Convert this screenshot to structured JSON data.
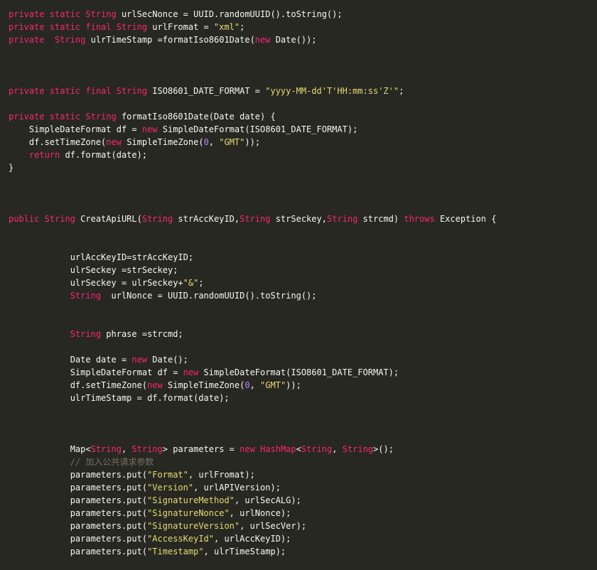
{
  "theme": {
    "background": "#272822",
    "plain": "#f8f8f2",
    "keyword": "#f92672",
    "string": "#e6db74",
    "number": "#ae81ff",
    "comment": "#75715e"
  },
  "code": {
    "lines": [
      [
        [
          "kw",
          "private static String"
        ],
        [
          "p",
          " urlSecNonce = UUID.randomUUID().toString();"
        ]
      ],
      [
        [
          "kw",
          "private static final String"
        ],
        [
          "p",
          " urlFromat = "
        ],
        [
          "str",
          "\"xml\""
        ],
        [
          "p",
          ";"
        ]
      ],
      [
        [
          "kw",
          "private  String"
        ],
        [
          "p",
          " ulrTimeStamp =formatIso8601Date("
        ],
        [
          "kw",
          "new"
        ],
        [
          "p",
          " Date());"
        ]
      ],
      [],
      [],
      [],
      [
        [
          "kw",
          "private static final String"
        ],
        [
          "p",
          " ISO8601_DATE_FORMAT = "
        ],
        [
          "str",
          "\"yyyy-MM-dd'T'HH:mm:ss'Z'\""
        ],
        [
          "p",
          ";"
        ]
      ],
      [],
      [
        [
          "kw",
          "private static String"
        ],
        [
          "p",
          " formatIso8601Date(Date date) {"
        ]
      ],
      [
        [
          "p",
          "    SimpleDateFormat df = "
        ],
        [
          "kw",
          "new"
        ],
        [
          "p",
          " SimpleDateFormat(ISO8601_DATE_FORMAT);"
        ]
      ],
      [
        [
          "p",
          "    df.setTimeZone("
        ],
        [
          "kw",
          "new"
        ],
        [
          "p",
          " SimpleTimeZone("
        ],
        [
          "num",
          "0"
        ],
        [
          "p",
          ", "
        ],
        [
          "str",
          "\"GMT\""
        ],
        [
          "p",
          "));"
        ]
      ],
      [
        [
          "p",
          "    "
        ],
        [
          "kw",
          "return"
        ],
        [
          "p",
          " df.format(date);"
        ]
      ],
      [
        [
          "p",
          "}"
        ]
      ],
      [],
      [],
      [],
      [
        [
          "kw",
          "public String"
        ],
        [
          "p",
          " CreatApiURL("
        ],
        [
          "kw",
          "String"
        ],
        [
          "p",
          " strAccKeyID,"
        ],
        [
          "kw",
          "String"
        ],
        [
          "p",
          " strSeckey,"
        ],
        [
          "kw",
          "String"
        ],
        [
          "p",
          " strcmd) "
        ],
        [
          "kw",
          "throws"
        ],
        [
          "p",
          " Exception {"
        ]
      ],
      [],
      [],
      [
        [
          "p",
          "            urlAccKeyID=strAccKeyID;"
        ]
      ],
      [
        [
          "p",
          "            ulrSeckey =strSeckey;"
        ]
      ],
      [
        [
          "p",
          "            ulrSeckey = ulrSeckey+"
        ],
        [
          "str",
          "\"&\""
        ],
        [
          "p",
          ";"
        ]
      ],
      [
        [
          "p",
          "            "
        ],
        [
          "kw",
          "String"
        ],
        [
          "p",
          "  urlNonce = UUID.randomUUID().toString();"
        ]
      ],
      [],
      [],
      [
        [
          "p",
          "            "
        ],
        [
          "kw",
          "String"
        ],
        [
          "p",
          " phrase =strcmd;"
        ]
      ],
      [],
      [
        [
          "p",
          "            Date date = "
        ],
        [
          "kw",
          "new"
        ],
        [
          "p",
          " Date();"
        ]
      ],
      [
        [
          "p",
          "            SimpleDateFormat df = "
        ],
        [
          "kw",
          "new"
        ],
        [
          "p",
          " SimpleDateFormat(ISO8601_DATE_FORMAT);"
        ]
      ],
      [
        [
          "p",
          "            df.setTimeZone("
        ],
        [
          "kw",
          "new"
        ],
        [
          "p",
          " SimpleTimeZone("
        ],
        [
          "num",
          "0"
        ],
        [
          "p",
          ", "
        ],
        [
          "str",
          "\"GMT\""
        ],
        [
          "p",
          "));"
        ]
      ],
      [
        [
          "p",
          "            ulrTimeStamp = df.format(date);"
        ]
      ],
      [],
      [],
      [],
      [
        [
          "p",
          "            Map<"
        ],
        [
          "kw",
          "String"
        ],
        [
          "p",
          ", "
        ],
        [
          "kw",
          "String"
        ],
        [
          "p",
          "> parameters = "
        ],
        [
          "kw",
          "new"
        ],
        [
          "p",
          " "
        ],
        [
          "kw",
          "HashMap"
        ],
        [
          "p",
          "<"
        ],
        [
          "kw",
          "String"
        ],
        [
          "p",
          ", "
        ],
        [
          "kw",
          "String"
        ],
        [
          "p",
          ">();"
        ]
      ],
      [
        [
          "p",
          "            "
        ],
        [
          "com",
          "// 加入公共请求参数"
        ]
      ],
      [
        [
          "p",
          "            parameters.put("
        ],
        [
          "str",
          "\"Format\""
        ],
        [
          "p",
          ", urlFromat);"
        ]
      ],
      [
        [
          "p",
          "            parameters.put("
        ],
        [
          "str",
          "\"Version\""
        ],
        [
          "p",
          ", urlAPIVersion);"
        ]
      ],
      [
        [
          "p",
          "            parameters.put("
        ],
        [
          "str",
          "\"SignatureMethod\""
        ],
        [
          "p",
          ", urlSecALG);"
        ]
      ],
      [
        [
          "p",
          "            parameters.put("
        ],
        [
          "str",
          "\"SignatureNonce\""
        ],
        [
          "p",
          ", urlNonce);"
        ]
      ],
      [
        [
          "p",
          "            parameters.put("
        ],
        [
          "str",
          "\"SignatureVersion\""
        ],
        [
          "p",
          ", urlSecVer);"
        ]
      ],
      [
        [
          "p",
          "            parameters.put("
        ],
        [
          "str",
          "\"AccessKeyId\""
        ],
        [
          "p",
          ", urlAccKeyID);"
        ]
      ],
      [
        [
          "p",
          "            parameters.put("
        ],
        [
          "str",
          "\"Timestamp\""
        ],
        [
          "p",
          ", ulrTimeStamp);"
        ]
      ]
    ]
  }
}
